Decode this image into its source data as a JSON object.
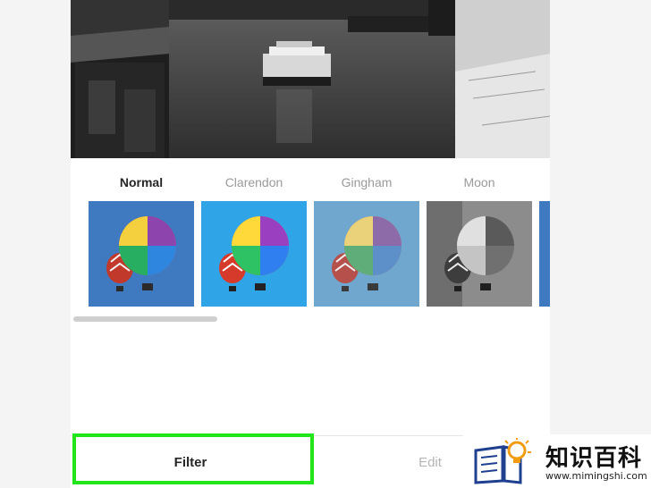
{
  "filters": [
    {
      "name": "Normal",
      "active": true
    },
    {
      "name": "Clarendon",
      "active": false
    },
    {
      "name": "Gingham",
      "active": false
    },
    {
      "name": "Moon",
      "active": false
    }
  ],
  "tabs": {
    "filter": "Filter",
    "edit": "Edit"
  },
  "watermark": {
    "title": "知识百科",
    "url": "www.mimingshi.com"
  },
  "colors": {
    "highlight": "#22e61a",
    "active_text": "#262626",
    "inactive_text": "#9a9a9a"
  }
}
